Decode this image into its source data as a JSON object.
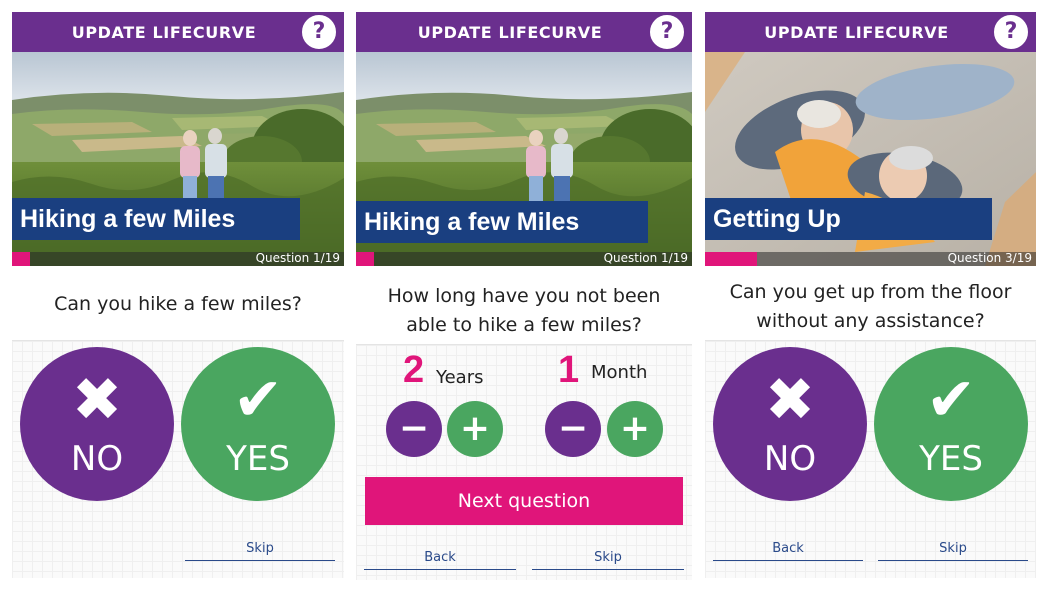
{
  "colors": {
    "purple": "#6a2f8e",
    "green": "#4aa660",
    "pink": "#e0157a",
    "navy": "#1a3f80"
  },
  "icons": {
    "help": "question-mark",
    "no": "cross",
    "yes": "checkmark",
    "minus": "minus",
    "plus": "plus"
  },
  "screens": [
    {
      "header_title": "UPDATE LIFECURVE",
      "help_glyph": "?",
      "activity_title": "Hiking a few Miles",
      "counter": "Question 1/19",
      "progress": 0.053,
      "question": "Can you hike a few miles?",
      "no_glyph": "✖",
      "no_label": "NO",
      "yes_glyph": "✔",
      "yes_label": "YES",
      "skip_label": "Skip"
    },
    {
      "header_title": "UPDATE LIFECURVE",
      "help_glyph": "?",
      "activity_title": "Hiking a few Miles",
      "counter": "Question 1/19",
      "progress": 0.053,
      "question_line1": "How long have you not been",
      "question_line2": "able to hike a few miles?",
      "years_value": "2",
      "years_unit": "Years",
      "months_value": "1",
      "months_unit": "Month",
      "minus_glyph": "−",
      "plus_glyph": "+",
      "next_label": "Next question",
      "back_label": "Back",
      "skip_label": "Skip"
    },
    {
      "header_title": "UPDATE LIFECURVE",
      "help_glyph": "?",
      "activity_title": "Getting Up",
      "counter": "Question 3/19",
      "progress": 0.158,
      "question_line1": "Can you get up from the floor",
      "question_line2": "without any assistance?",
      "no_glyph": "✖",
      "no_label": "NO",
      "yes_glyph": "✔",
      "yes_label": "YES",
      "back_label": "Back",
      "skip_label": "Skip"
    }
  ]
}
